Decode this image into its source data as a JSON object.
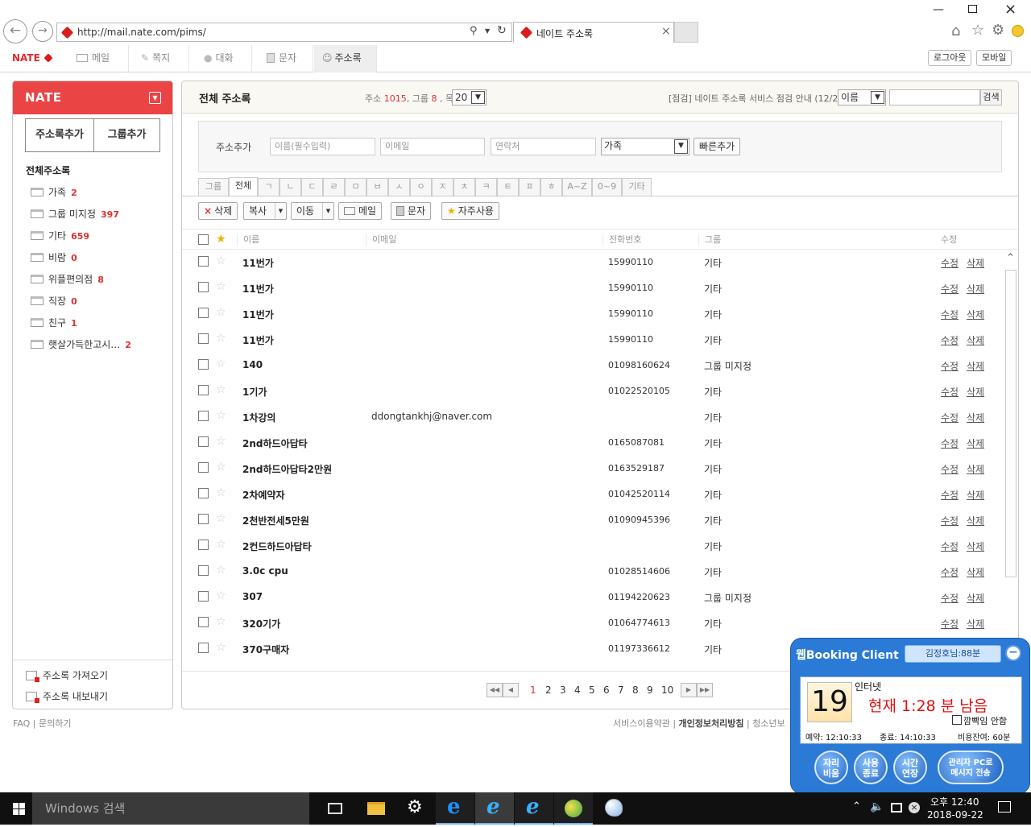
{
  "browser": {
    "url": "http://mail.nate.com/pims/",
    "tab_title": "네이트 주소록"
  },
  "nate_menu": {
    "logo": "NATE",
    "items": [
      {
        "label": "메일"
      },
      {
        "label": "쪽지"
      },
      {
        "label": "대화"
      },
      {
        "label": "문자"
      },
      {
        "label": "주소록"
      }
    ],
    "logout": "로그아웃",
    "mobile": "모바일"
  },
  "sidebar": {
    "logo": "NATE",
    "add_contact": "주소록추가",
    "add_group": "그룹추가",
    "all_label": "전체주소록",
    "folders": [
      {
        "label": "가족",
        "count": "2"
      },
      {
        "label": "그룹 미지정",
        "count": "397"
      },
      {
        "label": "기타",
        "count": "659"
      },
      {
        "label": "비람",
        "count": "0"
      },
      {
        "label": "위플편의점",
        "count": "8"
      },
      {
        "label": "직장",
        "count": "0"
      },
      {
        "label": "친구",
        "count": "1"
      },
      {
        "label": "햇살가득한고시…",
        "count": "2"
      }
    ],
    "import_label": "주소록 가져오기",
    "export_label": "주소록 내보내기"
  },
  "main": {
    "title": "전체 주소록",
    "stats": {
      "addr_label": "주소",
      "addr_count": "1015",
      "group_label": "그룹",
      "group_count": "8",
      "list_label": "목록",
      "list_value": "20"
    },
    "notice": "[점검] 네이트 주소록 서비스 점검 안내 (12/2)",
    "search_field": "이름",
    "search_button": "검색",
    "quick": {
      "label": "주소추가",
      "name_placeholder": "이름(필수입력)",
      "email_placeholder": "이메일",
      "phone_placeholder": "연락처",
      "group_value": "가족",
      "submit": "빠른추가"
    },
    "char_tabs": [
      "그룹",
      "전체",
      "ㄱ",
      "ㄴ",
      "ㄷ",
      "ㄹ",
      "ㅁ",
      "ㅂ",
      "ㅅ",
      "ㅇ",
      "ㅈ",
      "ㅊ",
      "ㅋ",
      "ㅌ",
      "ㅍ",
      "ㅎ",
      "A~Z",
      "0~9",
      "기타"
    ],
    "actions": {
      "delete": "삭제",
      "copy": "복사",
      "move": "이동",
      "mail": "메일",
      "sms": "문자",
      "favorite": "자주사용"
    },
    "columns": {
      "name": "이름",
      "email": "이메일",
      "phone": "전화번호",
      "group": "그룹",
      "edit": "수정"
    },
    "edit_label": "수정",
    "delete_label": "삭제",
    "rows": [
      {
        "name": "11번가",
        "email": "",
        "phone": "15990110",
        "group": "기타"
      },
      {
        "name": "11번가",
        "email": "",
        "phone": "15990110",
        "group": "기타"
      },
      {
        "name": "11번가",
        "email": "",
        "phone": "15990110",
        "group": "기타"
      },
      {
        "name": "11번가",
        "email": "",
        "phone": "15990110",
        "group": "기타"
      },
      {
        "name": "140",
        "email": "",
        "phone": "01098160624",
        "group": "그룹 미지정"
      },
      {
        "name": "1기가",
        "email": "",
        "phone": "01022520105",
        "group": "기타"
      },
      {
        "name": "1차강의",
        "email": "ddongtankhj@naver.com",
        "phone": "",
        "group": "기타"
      },
      {
        "name": "2nd하드아답타",
        "email": "",
        "phone": "0165087081",
        "group": "기타"
      },
      {
        "name": "2nd하드아답타2만원",
        "email": "",
        "phone": "0163529187",
        "group": "기타"
      },
      {
        "name": "2차예약자",
        "email": "",
        "phone": "01042520114",
        "group": "기타"
      },
      {
        "name": "2천반전세5만원",
        "email": "",
        "phone": "01090945396",
        "group": "기타"
      },
      {
        "name": "2컨드하드아답타",
        "email": "",
        "phone": "",
        "group": "기타"
      },
      {
        "name": "3.0c cpu",
        "email": "",
        "phone": "01028514606",
        "group": "기타"
      },
      {
        "name": "307",
        "email": "",
        "phone": "01194220623",
        "group": "그룹 미지정"
      },
      {
        "name": "320기가",
        "email": "",
        "phone": "01064774613",
        "group": "기타"
      },
      {
        "name": "370구매자",
        "email": "",
        "phone": "01197336612",
        "group": "기타"
      }
    ],
    "pages": [
      "1",
      "2",
      "3",
      "4",
      "5",
      "6",
      "7",
      "8",
      "9",
      "10"
    ]
  },
  "footer": {
    "faq": "FAQ",
    "inquiry": "문의하기",
    "terms": "서비스이용약관",
    "privacy": "개인정보처리방침",
    "youth": "청소년보"
  },
  "booking": {
    "title": "웹Booking Client",
    "user": "김정호님:88분",
    "seat": "19",
    "service": "인터넷",
    "remaining": "현재 1:28 분 남음",
    "blink_label": "깜빡임 안함",
    "reserve_label": "예약: 12:10:33",
    "end_label": "종료: 14:10:33",
    "fee_label": "비용잔여: 60분",
    "btn_leave": [
      "자리",
      "비움"
    ],
    "btn_end": [
      "사용",
      "종료"
    ],
    "btn_extend": [
      "시간",
      "연장"
    ],
    "btn_msg": [
      "관리자 PC로",
      "메시지 전송"
    ]
  },
  "taskbar": {
    "search": "Windows 검색",
    "time": "오후 12:40",
    "date": "2018-09-22"
  }
}
